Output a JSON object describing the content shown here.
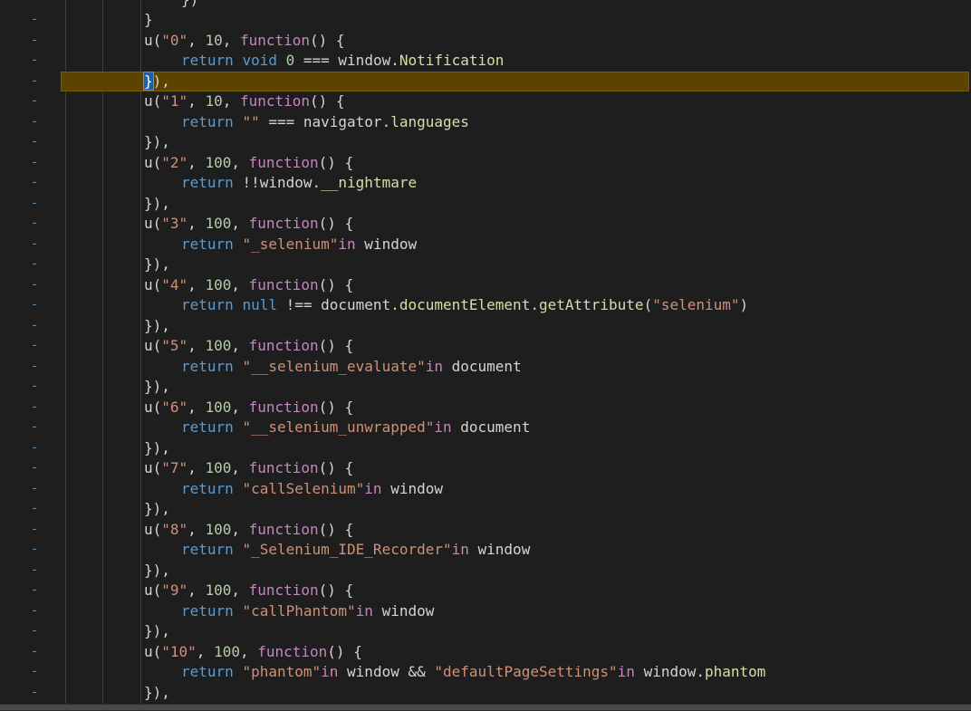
{
  "editor": {
    "lines": [
      {
        "indent": 5,
        "tokens": [
          {
            "t": "})",
            "c": "plain"
          }
        ]
      },
      {
        "indent": 4,
        "tokens": [
          {
            "t": "}",
            "c": "plain"
          }
        ]
      },
      {
        "indent": 4,
        "tokens": [
          {
            "t": "u(",
            "c": "plain"
          },
          {
            "t": "\"0\"",
            "c": "str"
          },
          {
            "t": ", ",
            "c": "plain"
          },
          {
            "t": "10",
            "c": "num"
          },
          {
            "t": ", ",
            "c": "plain"
          },
          {
            "t": "function",
            "c": "fn"
          },
          {
            "t": "() {",
            "c": "plain"
          }
        ]
      },
      {
        "indent": 5,
        "tokens": [
          {
            "t": "return ",
            "c": "kw"
          },
          {
            "t": "void ",
            "c": "kw"
          },
          {
            "t": "0",
            "c": "num"
          },
          {
            "t": " === window.",
            "c": "plain"
          },
          {
            "t": "Notification",
            "c": "prop"
          }
        ]
      },
      {
        "indent": 4,
        "highlight": true,
        "tokens": [
          {
            "t": "}",
            "c": "match"
          },
          {
            "t": "),",
            "c": "plain"
          }
        ]
      },
      {
        "indent": 4,
        "tokens": [
          {
            "t": "u(",
            "c": "plain"
          },
          {
            "t": "\"1\"",
            "c": "str"
          },
          {
            "t": ", ",
            "c": "plain"
          },
          {
            "t": "10",
            "c": "num"
          },
          {
            "t": ", ",
            "c": "plain"
          },
          {
            "t": "function",
            "c": "fn"
          },
          {
            "t": "() {",
            "c": "plain"
          }
        ]
      },
      {
        "indent": 5,
        "tokens": [
          {
            "t": "return ",
            "c": "kw"
          },
          {
            "t": "\"\"",
            "c": "str"
          },
          {
            "t": " === navigator.",
            "c": "plain"
          },
          {
            "t": "languages",
            "c": "prop"
          }
        ]
      },
      {
        "indent": 4,
        "tokens": [
          {
            "t": "}),",
            "c": "plain"
          }
        ]
      },
      {
        "indent": 4,
        "tokens": [
          {
            "t": "u(",
            "c": "plain"
          },
          {
            "t": "\"2\"",
            "c": "str"
          },
          {
            "t": ", ",
            "c": "plain"
          },
          {
            "t": "100",
            "c": "num"
          },
          {
            "t": ", ",
            "c": "plain"
          },
          {
            "t": "function",
            "c": "fn"
          },
          {
            "t": "() {",
            "c": "plain"
          }
        ]
      },
      {
        "indent": 5,
        "tokens": [
          {
            "t": "return ",
            "c": "kw"
          },
          {
            "t": "!!window.",
            "c": "plain"
          },
          {
            "t": "__nightmare",
            "c": "prop"
          }
        ]
      },
      {
        "indent": 4,
        "tokens": [
          {
            "t": "}),",
            "c": "plain"
          }
        ]
      },
      {
        "indent": 4,
        "tokens": [
          {
            "t": "u(",
            "c": "plain"
          },
          {
            "t": "\"3\"",
            "c": "str"
          },
          {
            "t": ", ",
            "c": "plain"
          },
          {
            "t": "100",
            "c": "num"
          },
          {
            "t": ", ",
            "c": "plain"
          },
          {
            "t": "function",
            "c": "fn"
          },
          {
            "t": "() {",
            "c": "plain"
          }
        ]
      },
      {
        "indent": 5,
        "tokens": [
          {
            "t": "return ",
            "c": "kw"
          },
          {
            "t": "\"_selenium\"",
            "c": "str"
          },
          {
            "t": "in",
            "c": "fn"
          },
          {
            "t": " window",
            "c": "plain"
          }
        ]
      },
      {
        "indent": 4,
        "tokens": [
          {
            "t": "}),",
            "c": "plain"
          }
        ]
      },
      {
        "indent": 4,
        "tokens": [
          {
            "t": "u(",
            "c": "plain"
          },
          {
            "t": "\"4\"",
            "c": "str"
          },
          {
            "t": ", ",
            "c": "plain"
          },
          {
            "t": "100",
            "c": "num"
          },
          {
            "t": ", ",
            "c": "plain"
          },
          {
            "t": "function",
            "c": "fn"
          },
          {
            "t": "() {",
            "c": "plain"
          }
        ]
      },
      {
        "indent": 5,
        "tokens": [
          {
            "t": "return ",
            "c": "kw"
          },
          {
            "t": "null",
            "c": "kw"
          },
          {
            "t": " !== document.",
            "c": "plain"
          },
          {
            "t": "documentElement",
            "c": "prop"
          },
          {
            "t": ".",
            "c": "plain"
          },
          {
            "t": "getAttribute",
            "c": "prop"
          },
          {
            "t": "(",
            "c": "plain"
          },
          {
            "t": "\"selenium\"",
            "c": "str"
          },
          {
            "t": ")",
            "c": "plain"
          }
        ]
      },
      {
        "indent": 4,
        "tokens": [
          {
            "t": "}),",
            "c": "plain"
          }
        ]
      },
      {
        "indent": 4,
        "tokens": [
          {
            "t": "u(",
            "c": "plain"
          },
          {
            "t": "\"5\"",
            "c": "str"
          },
          {
            "t": ", ",
            "c": "plain"
          },
          {
            "t": "100",
            "c": "num"
          },
          {
            "t": ", ",
            "c": "plain"
          },
          {
            "t": "function",
            "c": "fn"
          },
          {
            "t": "() {",
            "c": "plain"
          }
        ]
      },
      {
        "indent": 5,
        "tokens": [
          {
            "t": "return ",
            "c": "kw"
          },
          {
            "t": "\"__selenium_evaluate\"",
            "c": "str"
          },
          {
            "t": "in",
            "c": "fn"
          },
          {
            "t": " document",
            "c": "plain"
          }
        ]
      },
      {
        "indent": 4,
        "tokens": [
          {
            "t": "}),",
            "c": "plain"
          }
        ]
      },
      {
        "indent": 4,
        "tokens": [
          {
            "t": "u(",
            "c": "plain"
          },
          {
            "t": "\"6\"",
            "c": "str"
          },
          {
            "t": ", ",
            "c": "plain"
          },
          {
            "t": "100",
            "c": "num"
          },
          {
            "t": ", ",
            "c": "plain"
          },
          {
            "t": "function",
            "c": "fn"
          },
          {
            "t": "() {",
            "c": "plain"
          }
        ]
      },
      {
        "indent": 5,
        "tokens": [
          {
            "t": "return ",
            "c": "kw"
          },
          {
            "t": "\"__selenium_unwrapped\"",
            "c": "str"
          },
          {
            "t": "in",
            "c": "fn"
          },
          {
            "t": " document",
            "c": "plain"
          }
        ]
      },
      {
        "indent": 4,
        "tokens": [
          {
            "t": "}),",
            "c": "plain"
          }
        ]
      },
      {
        "indent": 4,
        "tokens": [
          {
            "t": "u(",
            "c": "plain"
          },
          {
            "t": "\"7\"",
            "c": "str"
          },
          {
            "t": ", ",
            "c": "plain"
          },
          {
            "t": "100",
            "c": "num"
          },
          {
            "t": ", ",
            "c": "plain"
          },
          {
            "t": "function",
            "c": "fn"
          },
          {
            "t": "() {",
            "c": "plain"
          }
        ]
      },
      {
        "indent": 5,
        "tokens": [
          {
            "t": "return ",
            "c": "kw"
          },
          {
            "t": "\"callSelenium\"",
            "c": "str"
          },
          {
            "t": "in",
            "c": "fn"
          },
          {
            "t": " window",
            "c": "plain"
          }
        ]
      },
      {
        "indent": 4,
        "tokens": [
          {
            "t": "}),",
            "c": "plain"
          }
        ]
      },
      {
        "indent": 4,
        "tokens": [
          {
            "t": "u(",
            "c": "plain"
          },
          {
            "t": "\"8\"",
            "c": "str"
          },
          {
            "t": ", ",
            "c": "plain"
          },
          {
            "t": "100",
            "c": "num"
          },
          {
            "t": ", ",
            "c": "plain"
          },
          {
            "t": "function",
            "c": "fn"
          },
          {
            "t": "() {",
            "c": "plain"
          }
        ]
      },
      {
        "indent": 5,
        "tokens": [
          {
            "t": "return ",
            "c": "kw"
          },
          {
            "t": "\"_Selenium_IDE_Recorder\"",
            "c": "str"
          },
          {
            "t": "in",
            "c": "fn"
          },
          {
            "t": " window",
            "c": "plain"
          }
        ]
      },
      {
        "indent": 4,
        "tokens": [
          {
            "t": "}),",
            "c": "plain"
          }
        ]
      },
      {
        "indent": 4,
        "tokens": [
          {
            "t": "u(",
            "c": "plain"
          },
          {
            "t": "\"9\"",
            "c": "str"
          },
          {
            "t": ", ",
            "c": "plain"
          },
          {
            "t": "100",
            "c": "num"
          },
          {
            "t": ", ",
            "c": "plain"
          },
          {
            "t": "function",
            "c": "fn"
          },
          {
            "t": "() {",
            "c": "plain"
          }
        ]
      },
      {
        "indent": 5,
        "tokens": [
          {
            "t": "return ",
            "c": "kw"
          },
          {
            "t": "\"callPhantom\"",
            "c": "str"
          },
          {
            "t": "in",
            "c": "fn"
          },
          {
            "t": " window",
            "c": "plain"
          }
        ]
      },
      {
        "indent": 4,
        "tokens": [
          {
            "t": "}),",
            "c": "plain"
          }
        ]
      },
      {
        "indent": 4,
        "tokens": [
          {
            "t": "u(",
            "c": "plain"
          },
          {
            "t": "\"10\"",
            "c": "str"
          },
          {
            "t": ", ",
            "c": "plain"
          },
          {
            "t": "100",
            "c": "num"
          },
          {
            "t": ", ",
            "c": "plain"
          },
          {
            "t": "function",
            "c": "fn"
          },
          {
            "t": "() {",
            "c": "plain"
          }
        ]
      },
      {
        "indent": 5,
        "tokens": [
          {
            "t": "return ",
            "c": "kw"
          },
          {
            "t": "\"phantom\"",
            "c": "str"
          },
          {
            "t": "in",
            "c": "fn"
          },
          {
            "t": " window && ",
            "c": "plain"
          },
          {
            "t": "\"defaultPageSettings\"",
            "c": "str"
          },
          {
            "t": "in",
            "c": "fn"
          },
          {
            "t": " window.",
            "c": "plain"
          },
          {
            "t": "phantom",
            "c": "prop"
          }
        ]
      },
      {
        "indent": 4,
        "tokens": [
          {
            "t": "}),",
            "c": "plain"
          }
        ]
      }
    ],
    "gutter_marker": "-",
    "colors": {
      "background": "#1e1e1e",
      "keyword": "#569cd6",
      "function_keyword": "#c586c0",
      "string": "#ce9178",
      "number": "#b5cea8",
      "property": "#dcdcaa",
      "highlight": "#5c4400"
    }
  }
}
